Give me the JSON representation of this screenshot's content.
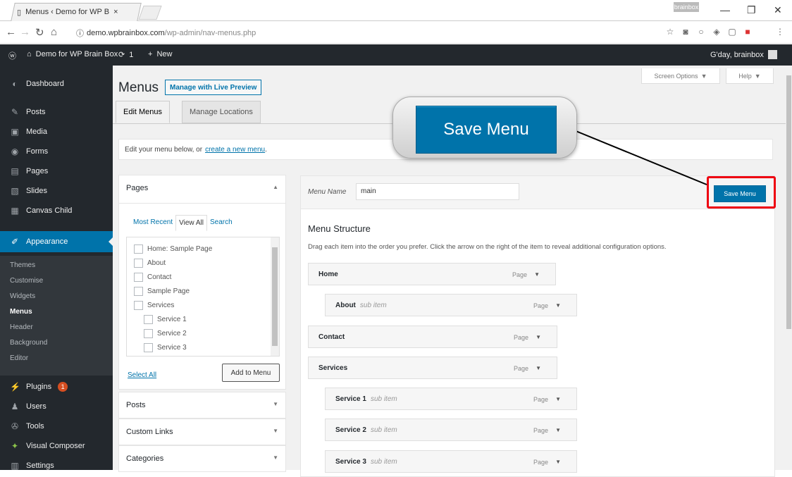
{
  "browser": {
    "tab_title": "Menus ‹ Demo for WP B",
    "url_host": "demo.wpbrainbox.com",
    "url_path": "/wp-admin/nav-menus.php",
    "profile": "brainbox"
  },
  "adminbar": {
    "site": "Demo for WP Brain Box",
    "updates": "1",
    "new": "New",
    "greeting": "G'day, brainbox"
  },
  "sidebar": {
    "items": [
      {
        "label": "Dashboard",
        "icon": "dashboard-icon"
      },
      {
        "label": "Posts",
        "icon": "pin-icon"
      },
      {
        "label": "Media",
        "icon": "media-icon"
      },
      {
        "label": "Forms",
        "icon": "forms-icon"
      },
      {
        "label": "Pages",
        "icon": "pages-icon"
      },
      {
        "label": "Slides",
        "icon": "slides-icon"
      },
      {
        "label": "Canvas Child",
        "icon": "canvas-icon"
      },
      {
        "label": "Appearance",
        "icon": "brush-icon"
      }
    ],
    "submenu": [
      "Themes",
      "Customise",
      "Widgets",
      "Menus",
      "Header",
      "Background",
      "Editor"
    ],
    "lower": [
      {
        "label": "Plugins",
        "icon": "plugin-icon"
      },
      {
        "label": "Users",
        "icon": "users-icon"
      },
      {
        "label": "Tools",
        "icon": "tools-icon"
      },
      {
        "label": "Visual Composer",
        "icon": "vc-icon"
      },
      {
        "label": "Settings",
        "icon": "settings-icon"
      }
    ],
    "plugins_badge": "1"
  },
  "main": {
    "screen_options": "Screen Options",
    "help": "Help",
    "title": "Menus",
    "live_preview": "Manage with Live Preview",
    "tabs": [
      "Edit Menus",
      "Manage Locations"
    ],
    "notice_text": "Edit your menu below, or",
    "notice_link": "create a new menu",
    "notice_end": "."
  },
  "pages_box": {
    "header": "Pages",
    "tabs": [
      "Most Recent",
      "View All",
      "Search"
    ],
    "pages": [
      "Home: Sample Page",
      "About",
      "Contact",
      "Sample Page",
      "Services",
      "Service 1",
      "Service 2",
      "Service 3"
    ],
    "select_all": "Select All",
    "add_to_menu": "Add to Menu"
  },
  "other_boxes": [
    "Posts",
    "Custom Links",
    "Categories"
  ],
  "menu_editor": {
    "menu_name_label": "Menu Name",
    "menu_name_value": "main",
    "save_button": "Save Menu",
    "structure_title": "Menu Structure",
    "structure_desc": "Drag each item into the order you prefer. Click the arrow on the right of the item to reveal additional configuration options.",
    "items": [
      {
        "title": "Home",
        "sub": "",
        "type": "Page"
      },
      {
        "title": "About",
        "sub": "sub item",
        "type": "Page"
      },
      {
        "title": "Contact",
        "sub": "",
        "type": "Page"
      },
      {
        "title": "Services",
        "sub": "",
        "type": "Page"
      },
      {
        "title": "Service 1",
        "sub": "sub item",
        "type": "Page"
      },
      {
        "title": "Service 2",
        "sub": "sub item",
        "type": "Page"
      },
      {
        "title": "Service 3",
        "sub": "sub item",
        "type": "Page"
      }
    ]
  },
  "callout": {
    "label": "Save Menu"
  },
  "colors": {
    "wp_blue": "#0073aa",
    "admin_dark": "#23282d",
    "highlight_red": "#ee1111"
  }
}
